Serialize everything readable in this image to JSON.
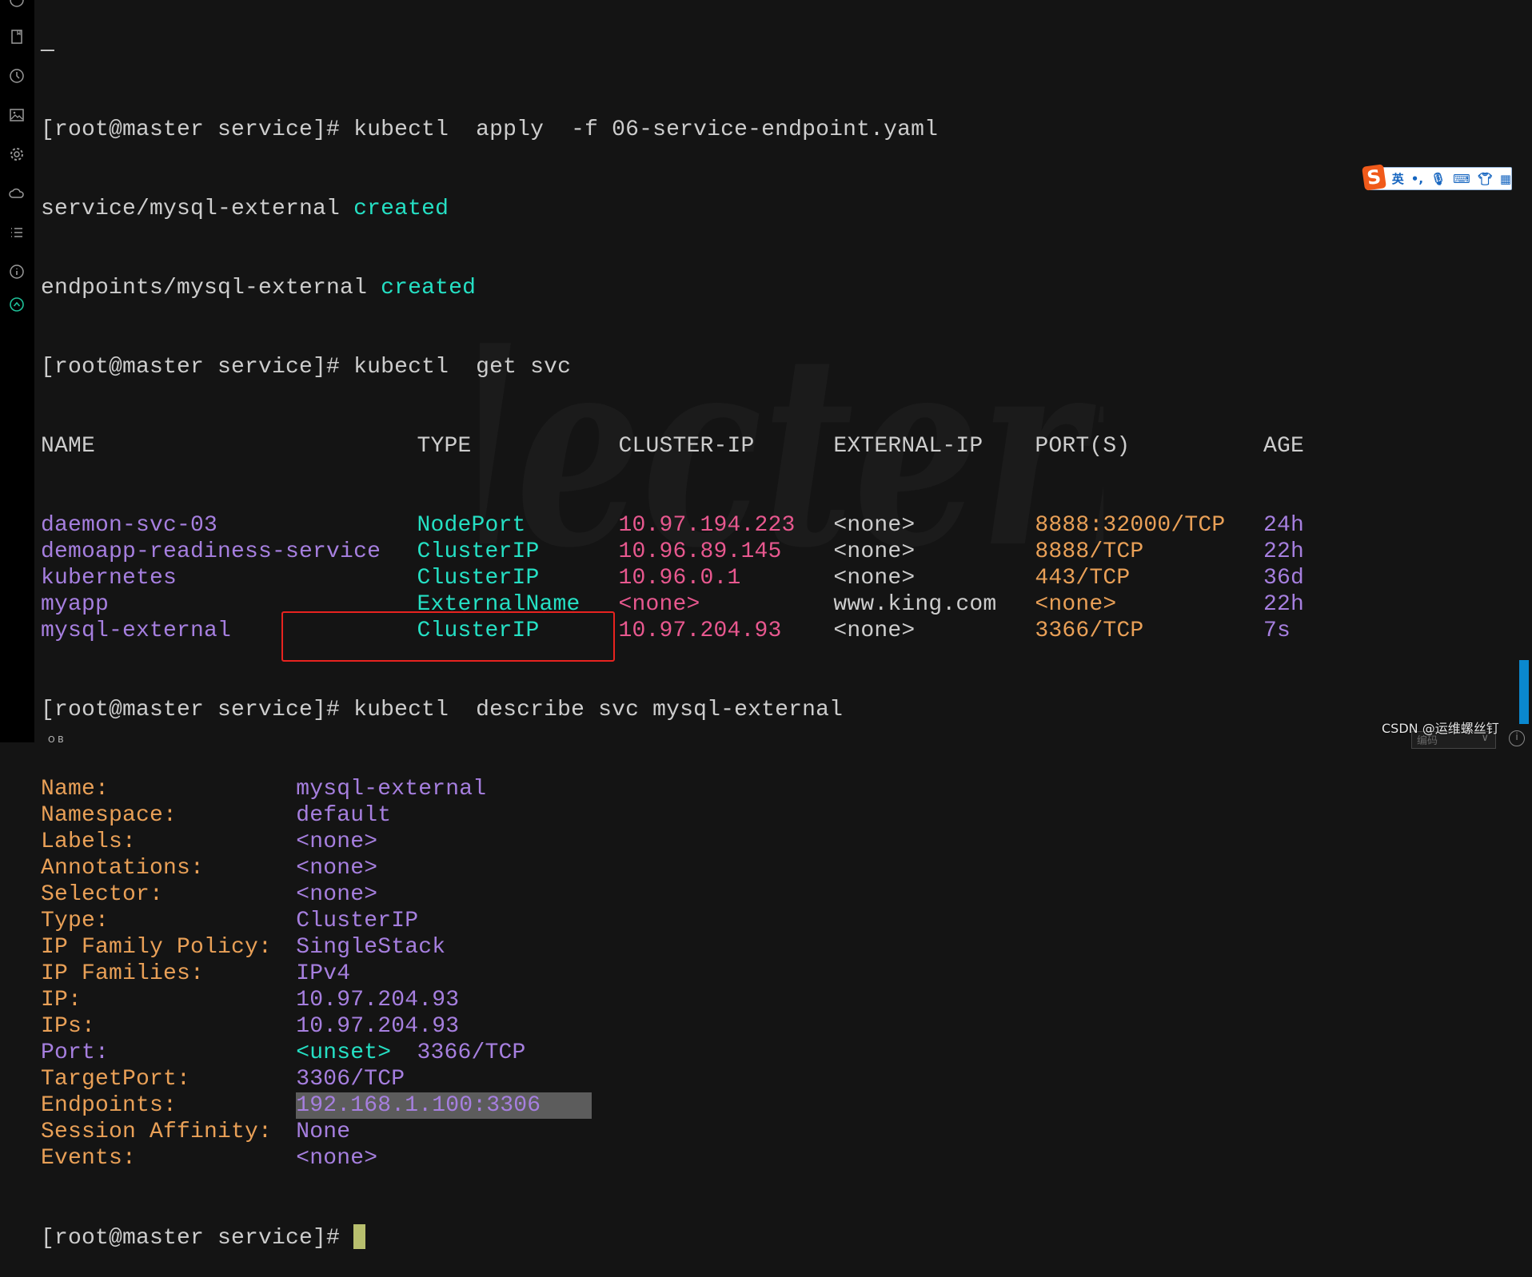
{
  "terminal": {
    "top_fragment": "—",
    "prompt": "[root@master service]#",
    "cmd_apply": " kubectl  apply  -f 06-service-endpoint.yaml",
    "out1_name": "service/mysql-external ",
    "out1_status": "created",
    "out2_name": "endpoints/mysql-external ",
    "out2_status": "created",
    "cmd_get": " kubectl  get svc",
    "svc_headers": [
      "NAME",
      "TYPE",
      "CLUSTER-IP",
      "EXTERNAL-IP",
      "PORT(S)",
      "AGE"
    ],
    "svc_rows": [
      [
        "daemon-svc-03",
        "NodePort",
        "10.97.194.223",
        "<none>",
        "8888:32000/TCP",
        "24h"
      ],
      [
        "demoapp-readiness-service",
        "ClusterIP",
        "10.96.89.145",
        "<none>",
        "8888/TCP",
        "22h"
      ],
      [
        "kubernetes",
        "ClusterIP",
        "10.96.0.1",
        "<none>",
        "443/TCP",
        "36d"
      ],
      [
        "myapp",
        "ExternalName",
        "<none>",
        "www.king.com",
        "<none>",
        "22h"
      ],
      [
        "mysql-external",
        "ClusterIP",
        "10.97.204.93",
        "<none>",
        "3366/TCP",
        "7s"
      ]
    ],
    "cmd_describe": " kubectl  describe svc mysql-external",
    "describe": [
      {
        "label": "Name:",
        "value": "mysql-external"
      },
      {
        "label": "Namespace:",
        "value": "default"
      },
      {
        "label": "Labels:",
        "value": "<none>"
      },
      {
        "label": "Annotations:",
        "value": "<none>"
      },
      {
        "label": "Selector:",
        "value": "<none>"
      },
      {
        "label": "Type:",
        "value": "ClusterIP"
      },
      {
        "label": "IP Family Policy:",
        "value": "SingleStack"
      },
      {
        "label": "IP Families:",
        "value": "IPv4"
      },
      {
        "label": "IP:",
        "value": "10.97.204.93"
      },
      {
        "label": "IPs:",
        "value": "10.97.204.93"
      },
      {
        "label": "Port:",
        "value": "<unset>",
        "value2": "3366/TCP"
      },
      {
        "label": "TargetPort:",
        "value": "3306/TCP"
      },
      {
        "label": "Endpoints:",
        "value": "192.168.1.100:3306"
      },
      {
        "label": "Session Affinity:",
        "value": "None"
      },
      {
        "label": "Events:",
        "value": "<none>"
      }
    ]
  },
  "watermark": "Electerm",
  "ime": {
    "logo": "S",
    "mode": "英",
    "punct": "•,"
  },
  "footer": {
    "credit": "CSDN @运维螺丝钉",
    "encoding_label": "编码",
    "fragment": "O  B"
  },
  "colors": {
    "background": "#141414",
    "purple": "#a67fdf",
    "teal": "#25e0c4",
    "pink": "#e8588f",
    "orange": "#e9a057",
    "highlight_box": "#e8231f",
    "scrollbar": "#0a88cf"
  }
}
